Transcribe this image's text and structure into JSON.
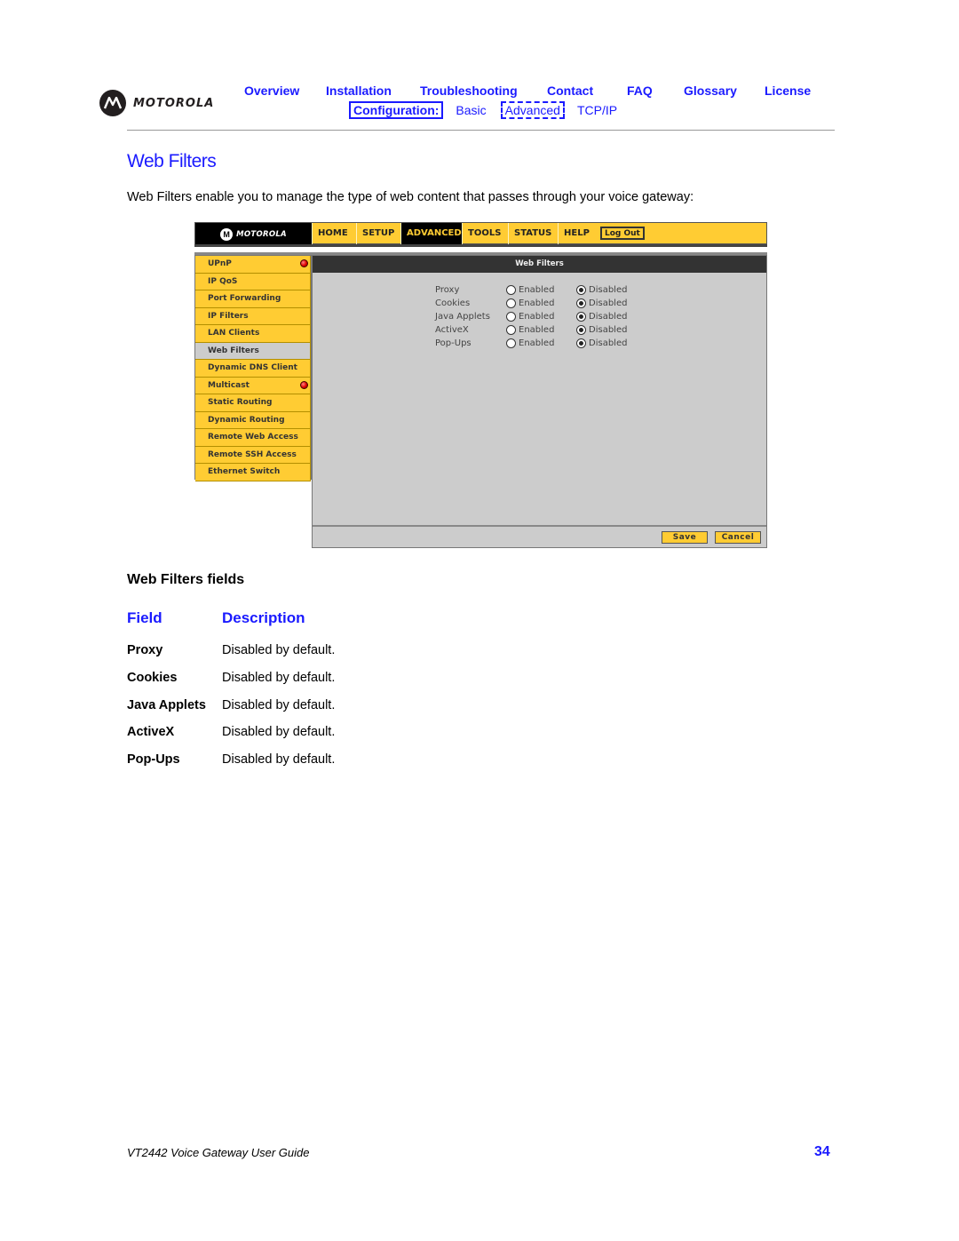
{
  "brand": "MOTOROLA",
  "top_nav": [
    "Overview",
    "Installation",
    "Troubleshooting",
    "Contact",
    "FAQ",
    "Glossary",
    "License"
  ],
  "sub_nav": {
    "label": "Configuration:",
    "items": [
      "Basic",
      "Advanced",
      "TCP/IP"
    ],
    "active": "Advanced"
  },
  "page_title": "Web Filters",
  "intro": "Web Filters enable you to manage the type of web content that passes through your voice gateway:",
  "screenshot": {
    "brand": "MOTOROLA",
    "tabs": [
      "HOME",
      "SETUP",
      "ADVANCED",
      "TOOLS",
      "STATUS",
      "HELP"
    ],
    "active_tab": "ADVANCED",
    "logout": "Log Out",
    "sidebar": [
      {
        "label": "UPnP",
        "alert": true
      },
      {
        "label": "IP QoS",
        "alert": false
      },
      {
        "label": "Port Forwarding",
        "alert": false
      },
      {
        "label": "IP Filters",
        "alert": false
      },
      {
        "label": "LAN Clients",
        "alert": false
      },
      {
        "label": "Web Filters",
        "alert": false,
        "active": true
      },
      {
        "label": "Dynamic DNS Client",
        "alert": false
      },
      {
        "label": "Multicast",
        "alert": true
      },
      {
        "label": "Static Routing",
        "alert": false
      },
      {
        "label": "Dynamic Routing",
        "alert": false
      },
      {
        "label": "Remote Web Access",
        "alert": false
      },
      {
        "label": "Remote SSH Access",
        "alert": false
      },
      {
        "label": "Ethernet Switch",
        "alert": false
      }
    ],
    "panel_title": "Web Filters",
    "option_labels": {
      "enabled": "Enabled",
      "disabled": "Disabled"
    },
    "settings": [
      {
        "name": "Proxy",
        "value": "Disabled"
      },
      {
        "name": "Cookies",
        "value": "Disabled"
      },
      {
        "name": "Java Applets",
        "value": "Disabled"
      },
      {
        "name": "ActiveX",
        "value": "Disabled"
      },
      {
        "name": "Pop-Ups",
        "value": "Disabled"
      }
    ],
    "save": "Save",
    "cancel": "Cancel"
  },
  "fields_heading": "Web Filters fields",
  "table": {
    "headers": [
      "Field",
      "Description"
    ],
    "rows": [
      {
        "field": "Proxy",
        "description": "Disabled by default."
      },
      {
        "field": "Cookies",
        "description": "Disabled by default."
      },
      {
        "field": "Java Applets",
        "description": "Disabled by default."
      },
      {
        "field": "ActiveX",
        "description": "Disabled by default."
      },
      {
        "field": "Pop-Ups",
        "description": "Disabled by default."
      }
    ]
  },
  "footer": {
    "doc_title": "VT2442 Voice Gateway User Guide",
    "page_number": "34"
  },
  "colors": {
    "link_blue": "#1a1aff",
    "ui_yellow": "#ffcc33",
    "ui_gray": "#cccccc"
  }
}
